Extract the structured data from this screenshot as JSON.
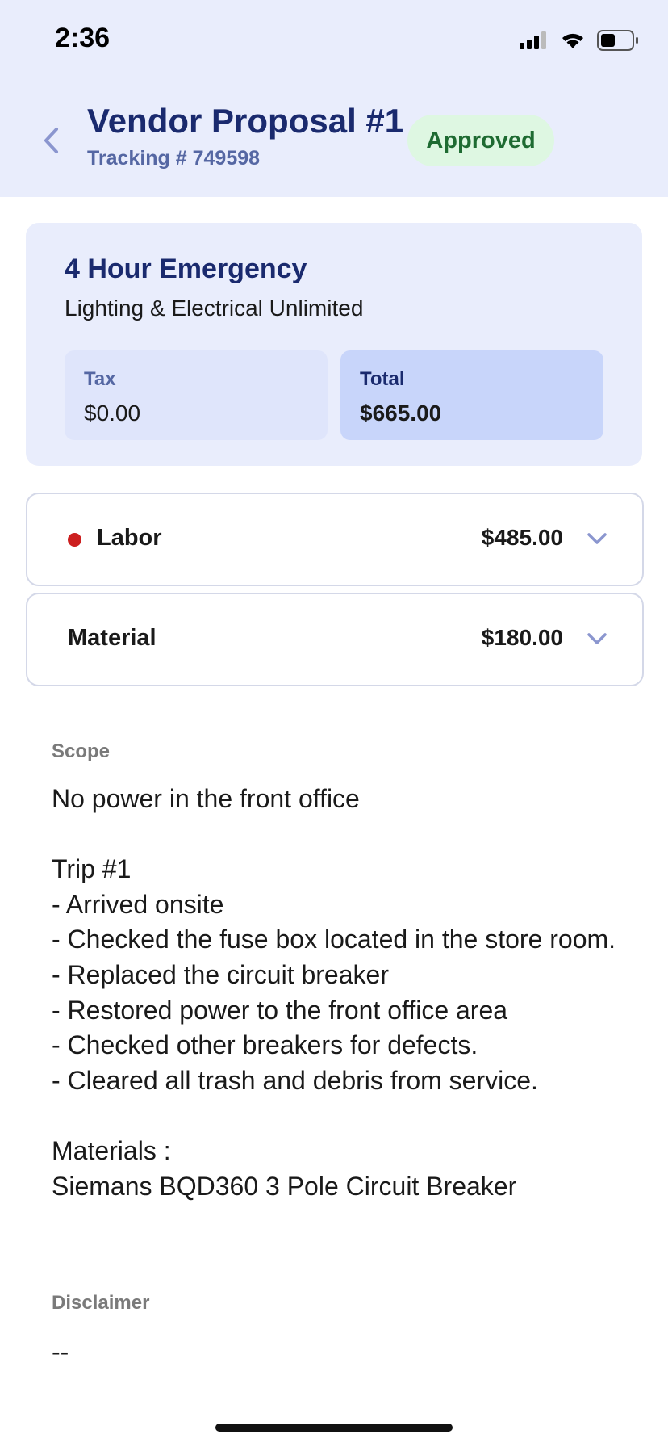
{
  "status_bar": {
    "time": "2:36"
  },
  "header": {
    "title": "Vendor Proposal #1",
    "tracking": "Tracking # 749598",
    "status_badge": "Approved",
    "back_icon": "chevron-left-icon"
  },
  "summary": {
    "title": "4 Hour Emergency",
    "vendor": "Lighting & Electrical Unlimited",
    "tax": {
      "label": "Tax",
      "value": "$0.00"
    },
    "total": {
      "label": "Total",
      "value": "$665.00"
    }
  },
  "line_items": [
    {
      "label": "Labor",
      "amount": "$485.00",
      "indicator_color": "#cc1f1f"
    },
    {
      "label": "Material",
      "amount": "$180.00"
    }
  ],
  "scope": {
    "label": "Scope",
    "text": "No power in the front office\n\nTrip #1\n- Arrived onsite\n- Checked the fuse box located in the store room.\n- Replaced the circuit breaker\n- Restored power to the front office area\n- Checked other breakers for defects.\n- Cleared all trash and debris from service.\n\nMaterials :\nSiemans BQD360 3 Pole Circuit Breaker"
  },
  "disclaimer": {
    "label": "Disclaimer",
    "text": "--"
  },
  "colors": {
    "header_bg": "#e9edfc",
    "title": "#1a2a6e",
    "badge_bg": "#def7e2",
    "badge_text": "#1e6b32",
    "total_bg": "#c8d5fa"
  }
}
